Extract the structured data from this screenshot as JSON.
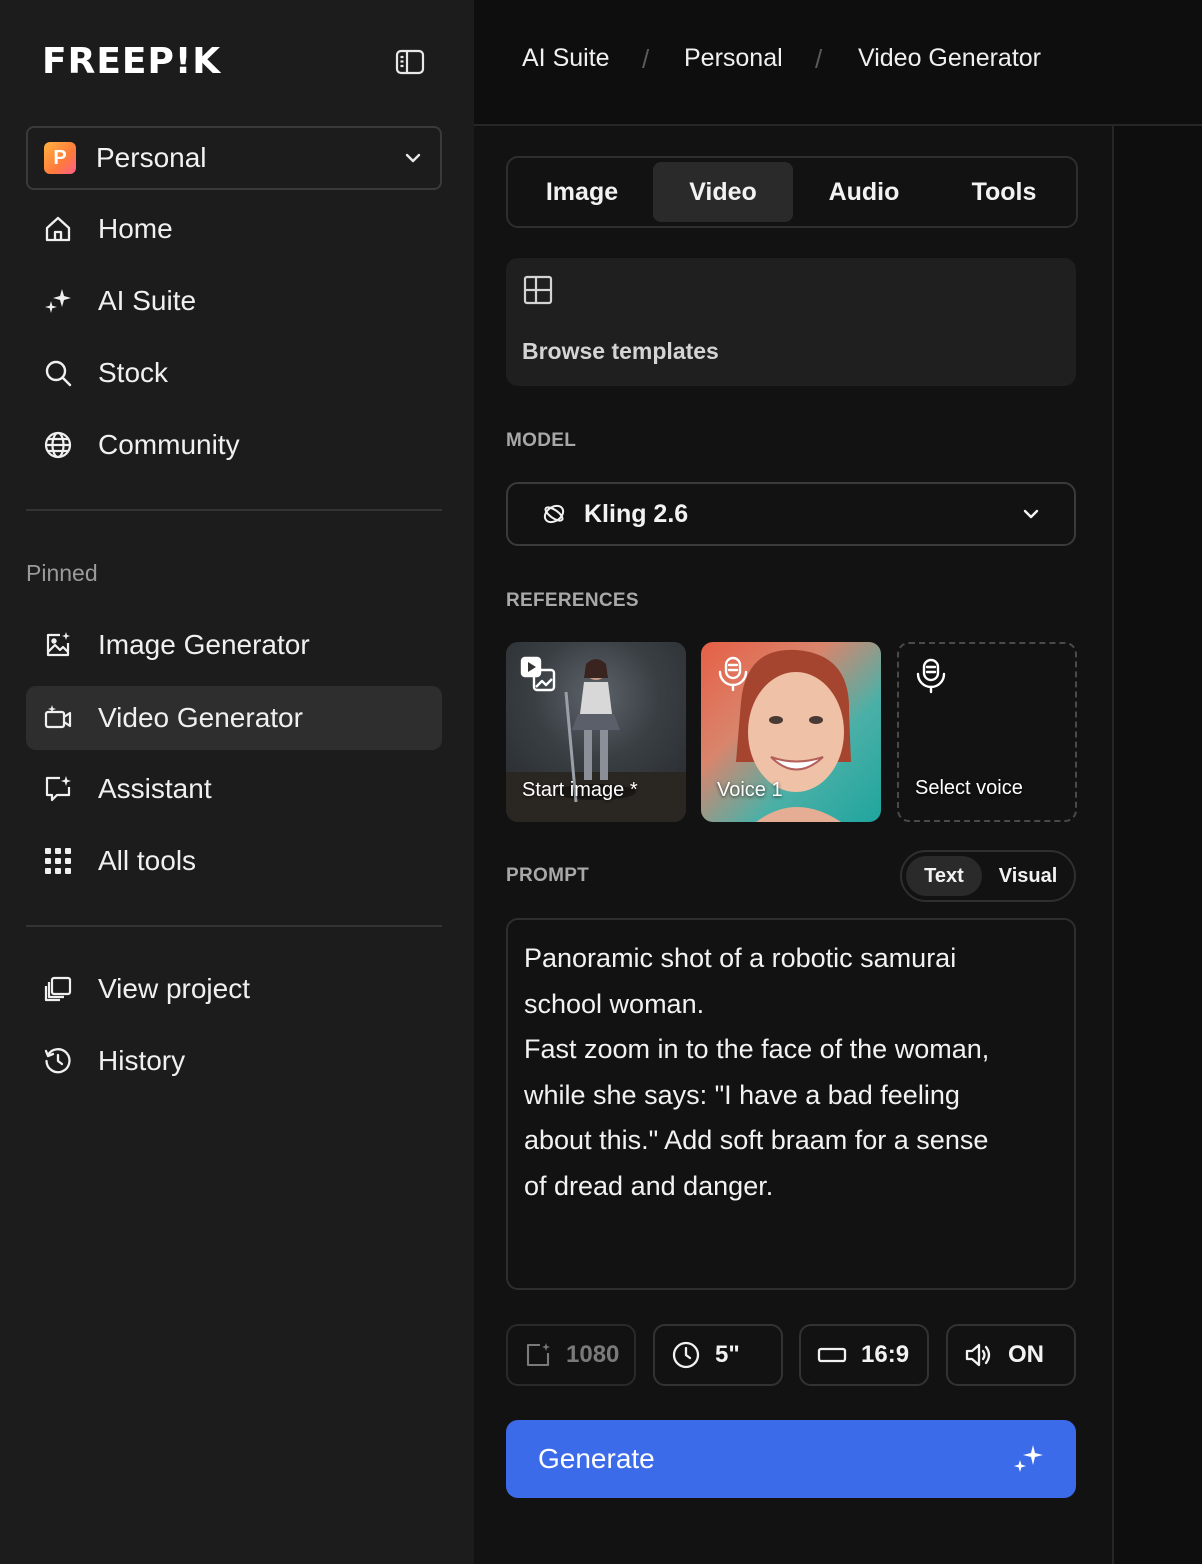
{
  "brand": {
    "logo_text": "FREEP!K"
  },
  "workspace": {
    "badge": "P",
    "name": "Personal"
  },
  "nav": {
    "home": "Home",
    "ai_suite": "AI Suite",
    "stock": "Stock",
    "community": "Community",
    "pinned_label": "Pinned",
    "image_generator": "Image Generator",
    "video_generator": "Video Generator",
    "assistant": "Assistant",
    "all_tools": "All tools",
    "view_project": "View project",
    "history": "History"
  },
  "breadcrumb": [
    "AI Suite",
    "Personal",
    "Video Generator"
  ],
  "breadcrumb_sep": "/",
  "tabs": [
    "Image",
    "Video",
    "Audio",
    "Tools"
  ],
  "active_tab": "Video",
  "templates": {
    "label": "Browse templates"
  },
  "model": {
    "label": "MODEL",
    "value": "Kling 2.6"
  },
  "references": {
    "label": "REFERENCES",
    "items": [
      "Start image *",
      "Voice 1",
      "Select voice"
    ]
  },
  "prompt": {
    "label": "PROMPT",
    "modes": [
      "Text",
      "Visual"
    ],
    "active_mode": "Text",
    "text": "Panoramic shot of a robotic samurai\nschool woman.\nFast zoom in to the face of the woman,\nwhile she says: \"I have a bad feeling\nabout this.\" Add soft braam for a sense\nof dread and danger."
  },
  "options": {
    "resolution": "1080",
    "duration": "5\"",
    "aspect": "16:9",
    "audio": "ON"
  },
  "generate": {
    "label": "Generate"
  },
  "colors": {
    "accent": "#3b6be8",
    "sidebar_bg": "#1c1c1c",
    "panel_bg": "#121212"
  }
}
